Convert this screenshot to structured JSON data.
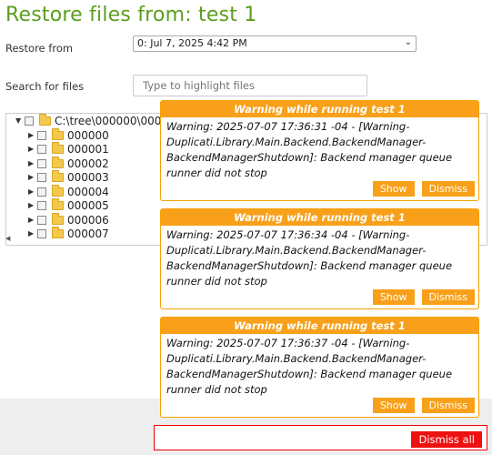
{
  "page": {
    "title": "Restore files from: test 1",
    "restore_from_label": "Restore from",
    "restore_from_value": "0: Jul 7, 2025 4:42 PM",
    "search_label": "Search for files",
    "search_placeholder": "Type to highlight files"
  },
  "tree": {
    "root": "C:\\tree\\000000\\000",
    "items": [
      "000000",
      "000001",
      "000002",
      "000003",
      "000004",
      "000005",
      "000006",
      "000007"
    ]
  },
  "toasts": [
    {
      "header": "Warning while running test 1",
      "body": "Warning: 2025-07-07 17:36:31 -04 - [Warning-Duplicati.Library.Main.Backend.BackendManager-BackendManagerShutdown]: Backend manager queue runner did not stop",
      "show": "Show",
      "dismiss": "Dismiss"
    },
    {
      "header": "Warning while running test 1",
      "body": "Warning: 2025-07-07 17:36:34 -04 - [Warning-Duplicati.Library.Main.Backend.BackendManager-BackendManagerShutdown]: Backend manager queue runner did not stop",
      "show": "Show",
      "dismiss": "Dismiss"
    },
    {
      "header": "Warning while running test 1",
      "body": "Warning: 2025-07-07 17:36:37 -04 - [Warning-Duplicati.Library.Main.Backend.BackendManager-BackendManagerShutdown]: Backend manager queue runner did not stop",
      "show": "Show",
      "dismiss": "Dismiss"
    }
  ],
  "dismiss_all": "Dismiss all",
  "colors": {
    "title": "#5b9e1e",
    "toast": "#f8a01a",
    "dismiss_all": "#ee1111"
  }
}
